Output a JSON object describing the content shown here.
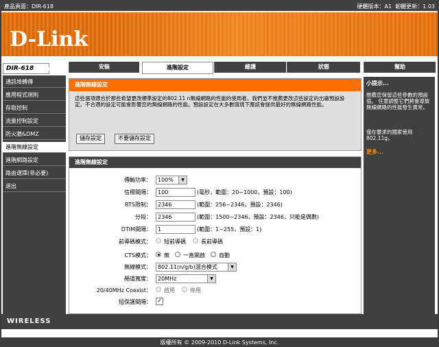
{
  "header": {
    "product": "產品頁面：DIR-618",
    "hw_version": "硬體版本：A1",
    "fw_version": "韌體更新：1.03"
  },
  "brand": {
    "logo_text": "D-Link",
    "model": "DIR-618",
    "footer_brand": "WIRELESS",
    "copyright": "版權所有 © 2009-2010 D-Link Systems, Inc."
  },
  "tabs": [
    {
      "label": "安裝"
    },
    {
      "label": "進階設定"
    },
    {
      "label": "維護"
    },
    {
      "label": "狀態"
    },
    {
      "label": "幫助"
    }
  ],
  "sidebar": {
    "items": [
      {
        "label": "通訊埠轉傳"
      },
      {
        "label": "應用程式規則"
      },
      {
        "label": "存取控制"
      },
      {
        "label": "流量控制設定"
      },
      {
        "label": "防火牆&DMZ"
      },
      {
        "label": "進階無線設定"
      },
      {
        "label": "進階網路設定"
      },
      {
        "label": "路由選擇(非必要)"
      },
      {
        "label": "退出"
      }
    ]
  },
  "section1": {
    "title": "進階無線設定",
    "description": "這些選項適合於那些希望更改標準設定的802.11 n無線網路的性能的使用者。我們並不推薦更改這些設定的出廠預設設定。不合適的設定可能會影響您的無線網路的性能。預設設定在大多數環境下應該會提供最好的無線網路性能。",
    "save_label": "儲存設定",
    "nosave_label": "不要儲存設定"
  },
  "section2": {
    "title": "進階無線設定",
    "fields": {
      "tx_power": {
        "label": "傳輸功率：",
        "value": "100%"
      },
      "beacon": {
        "label": "信標間隔：",
        "value": "100",
        "hint": "(毫秒，範圍：20~1000，預設：100)"
      },
      "rts": {
        "label": "RTS限制：",
        "value": "2346",
        "hint": "(範圍：256~2346，預設：2346)"
      },
      "frag": {
        "label": "分段：",
        "value": "2346",
        "hint": "(範圍：1500~2346，預設：2346，只能是偶數)"
      },
      "dtim": {
        "label": "DTIM間隔：",
        "value": "1",
        "hint": "(範圍：1~255，預設：1)"
      },
      "preamble": {
        "label": "前導碼模式：",
        "opt_short": "短前導碼",
        "opt_long": "長前導碼"
      },
      "cts": {
        "label": "CTS模式：",
        "opt_none": "無",
        "opt_always": "一直開啟",
        "opt_auto": "自動"
      },
      "wmode": {
        "label": "無線模式：",
        "value": "802.11(n/g/b)混合模式"
      },
      "bandwidth": {
        "label": "頻道寬度：",
        "value": "20MHz"
      },
      "coexist": {
        "label": "20/40MHz Coexist：",
        "opt_enable": "啟用",
        "opt_disable": "停用"
      },
      "guard": {
        "label": "短保護間隔："
      }
    }
  },
  "help": {
    "title": "小提示...",
    "p1": "推薦您保留這些參數的預設值。 任意調整它們將會導致無線網路的性能發生異常。",
    "p2": "僅在要求的國家使用802.11g。",
    "more": "更多..."
  }
}
